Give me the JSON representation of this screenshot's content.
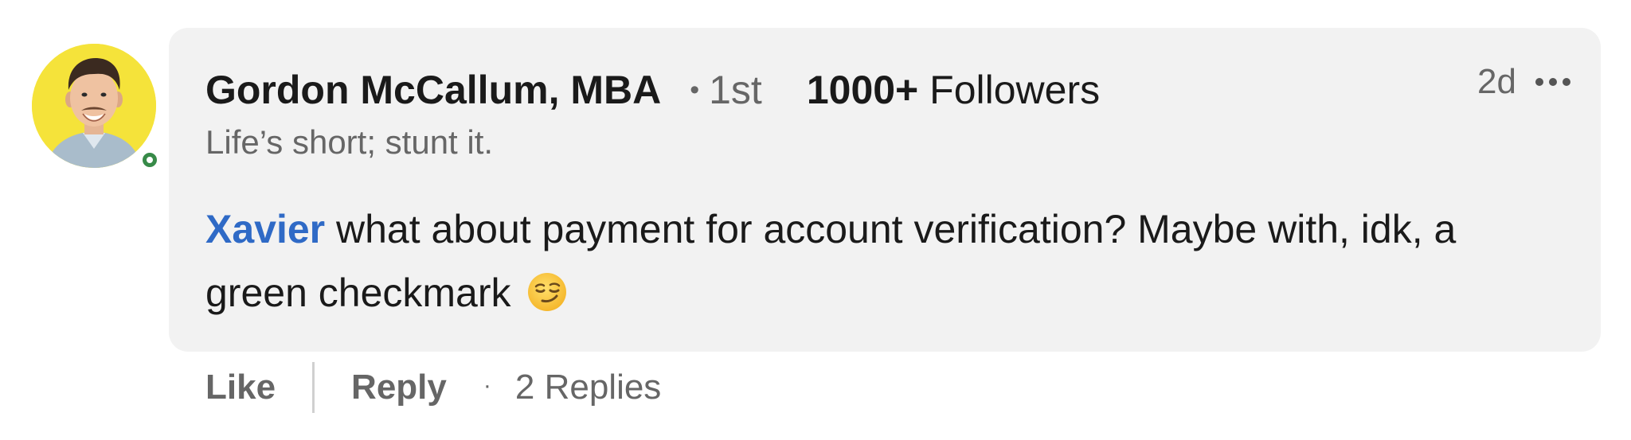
{
  "comment": {
    "author": {
      "name": "Gordon McCallum, MBA",
      "connection_degree": "1st",
      "followers_count": "1000+",
      "followers_label": "Followers",
      "headline": "Life’s short; stunt it.",
      "avatar_bg": "#f5e33a",
      "presence_color": "#378a48",
      "online": true
    },
    "timestamp": "2d",
    "more_icon": "more-horizontal-icon",
    "degree_separator": "•",
    "mention": "Xavier",
    "text": " what about payment for account verification? Maybe with, idk, a green checkmark",
    "emoji": "smirking-face-icon",
    "mention_color": "#2f6ac6",
    "bubble_color": "#f2f2f2"
  },
  "actions": {
    "like_label": "Like",
    "reply_label": "Reply",
    "separator": "·",
    "replies_label": "2 Replies"
  }
}
